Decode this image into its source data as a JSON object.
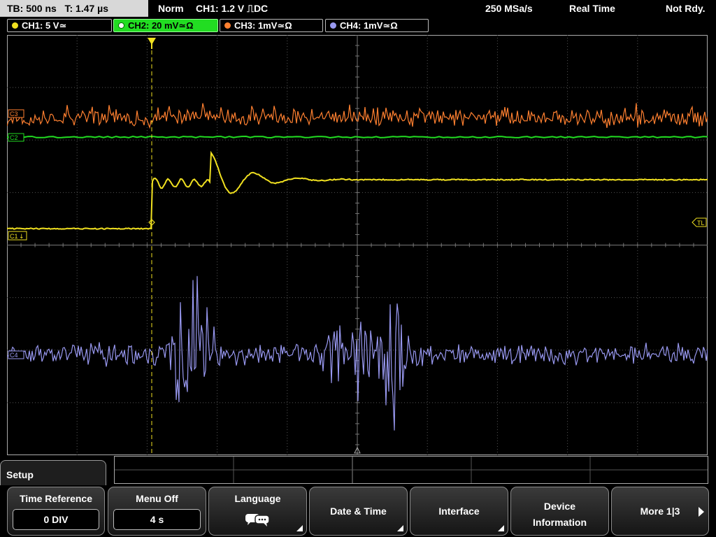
{
  "status_bar": {
    "timebase": "TB: 500 ns",
    "trigger_time": "T: 1.47 µs",
    "trigger_mode": "Norm",
    "trigger_source": "CH1: 1.2 V ⎍DC",
    "sample_rate": "250 MSa/s",
    "acq_mode": "Real Time",
    "status": "Not Rdy."
  },
  "channels": [
    {
      "label": "CH1: 5 V≃",
      "color": "#f0e020"
    },
    {
      "label": "CH2: 20 mV≃Ω",
      "color": "#22dd22",
      "active": true
    },
    {
      "label": "CH3: 1mV≃Ω",
      "color": "#ff8030"
    },
    {
      "label": "CH4: 1mV≃Ω",
      "color": "#9898f0"
    }
  ],
  "markers": {
    "ch1": "C1",
    "ch2": "C2",
    "ch3": "C3",
    "ch4": "C4",
    "trigger_level": "TL"
  },
  "menu": {
    "title": "Setup",
    "softkeys": [
      {
        "label": "Time Reference",
        "value": "0 DIV"
      },
      {
        "label": "Menu Off",
        "value": "4 s"
      },
      {
        "label": "Language",
        "icon": "speech-bubbles-icon"
      },
      {
        "label": "Date & Time"
      },
      {
        "label": "Interface"
      },
      {
        "label_line1": "Device",
        "label_line2": "Information"
      },
      {
        "label": "More 1|3"
      }
    ]
  },
  "colors": {
    "ch1": "#f0e020",
    "ch2": "#22dd22",
    "ch3": "#ff8030",
    "ch4": "#9898f0",
    "grid": "#555555"
  }
}
